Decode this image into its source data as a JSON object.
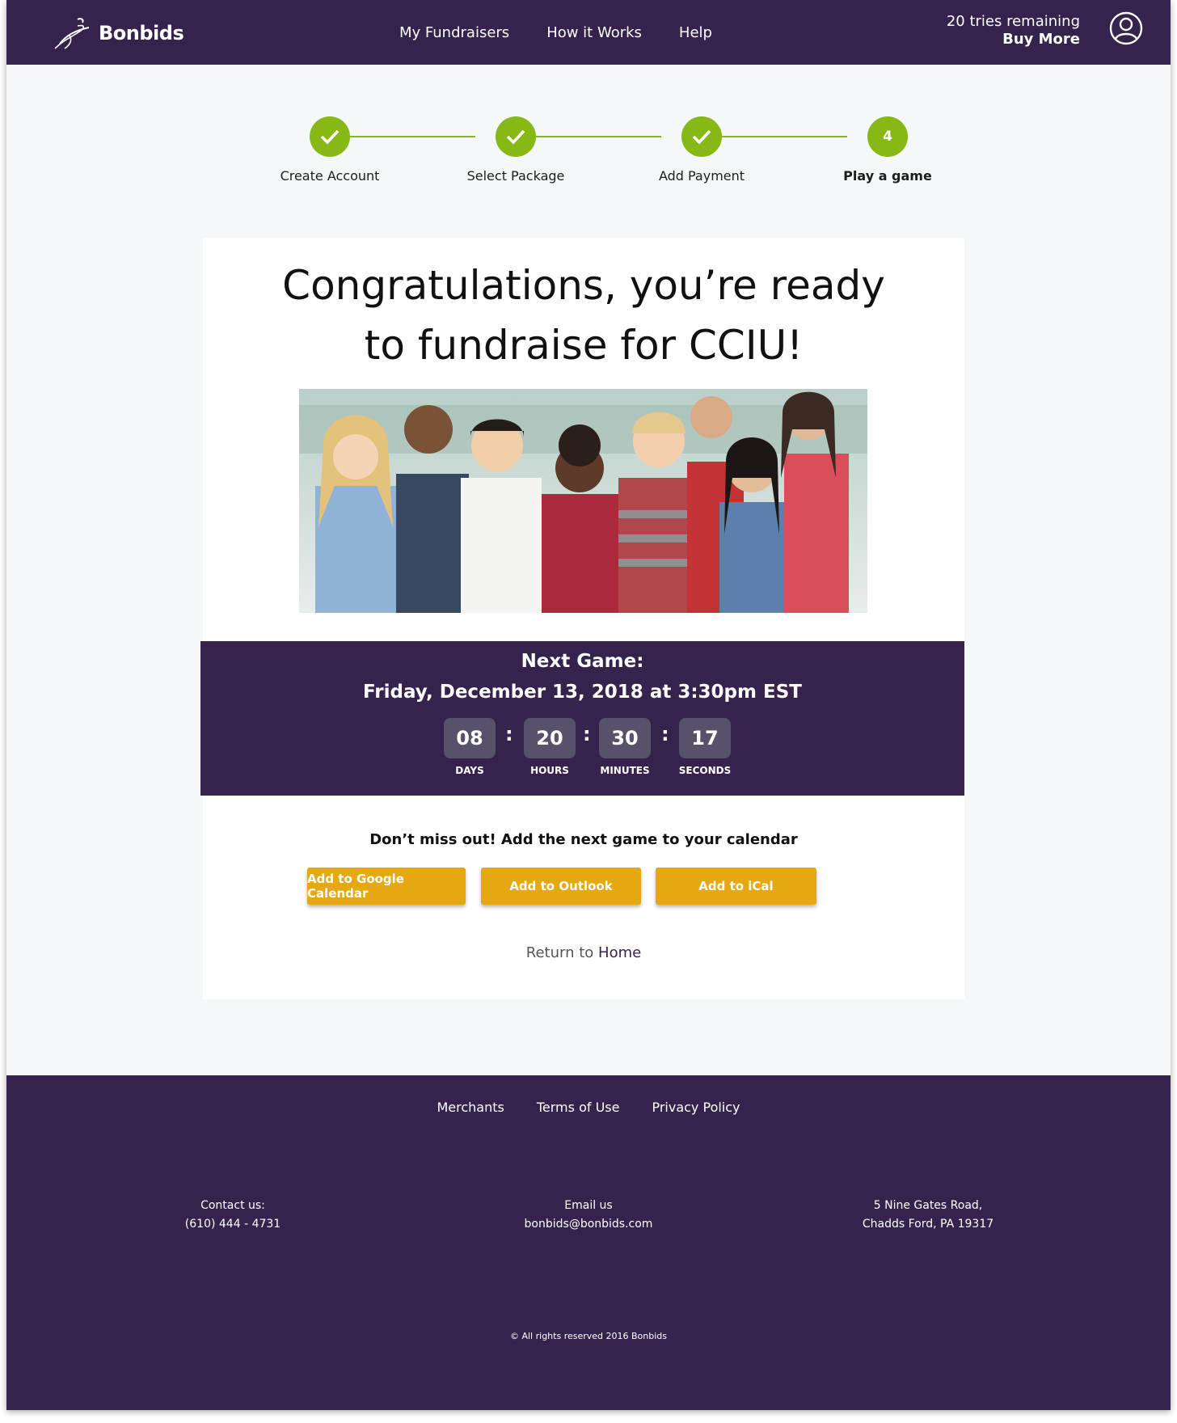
{
  "header": {
    "brand": "Bonbids",
    "nav": [
      "My Fundraisers",
      "How it Works",
      "Help"
    ],
    "tries_remaining": "20 tries remaining",
    "buy_more": "Buy More"
  },
  "stepper": {
    "steps": [
      {
        "label": "Create Account",
        "status": "complete"
      },
      {
        "label": "Select Package",
        "status": "complete"
      },
      {
        "label": "Add Payment",
        "status": "complete"
      },
      {
        "label": "Play a game",
        "status": "active",
        "number": "4"
      }
    ]
  },
  "main": {
    "headline_line1": "Congratulations, you’re ready",
    "headline_line2": "to fundraise for CCIU!",
    "next_game": {
      "title": "Next Game:",
      "date": "Friday, December 13, 2018 at 3:30pm EST",
      "countdown": [
        {
          "value": "08",
          "label": "DAYS"
        },
        {
          "value": "20",
          "label": "HOURS"
        },
        {
          "value": "30",
          "label": "MINUTES"
        },
        {
          "value": "17",
          "label": "SECONDS"
        }
      ]
    },
    "calendar_prompt": "Don’t miss out! Add the next game to your calendar",
    "buttons": [
      "Add to Google Calendar",
      "Add to Outlook",
      "Add to iCal"
    ],
    "return_prefix": "Return to",
    "return_link": "Home"
  },
  "footer": {
    "links": [
      "Merchants",
      "Terms of Use",
      "Privacy Policy"
    ],
    "contact_label": "Contact us:",
    "contact_phone": "(610) 444 - 4731",
    "email_label": "Email us",
    "email": "bonbids@bonbids.com",
    "address_line1": "5 Nine Gates Road,",
    "address_line2": "Chadds Ford, PA 19317",
    "copyright": "© All rights reserved 2016 Bonbids"
  },
  "colors": {
    "brand_purple": "#35234d",
    "step_green": "#86b816",
    "button_gold": "#e5a810"
  }
}
